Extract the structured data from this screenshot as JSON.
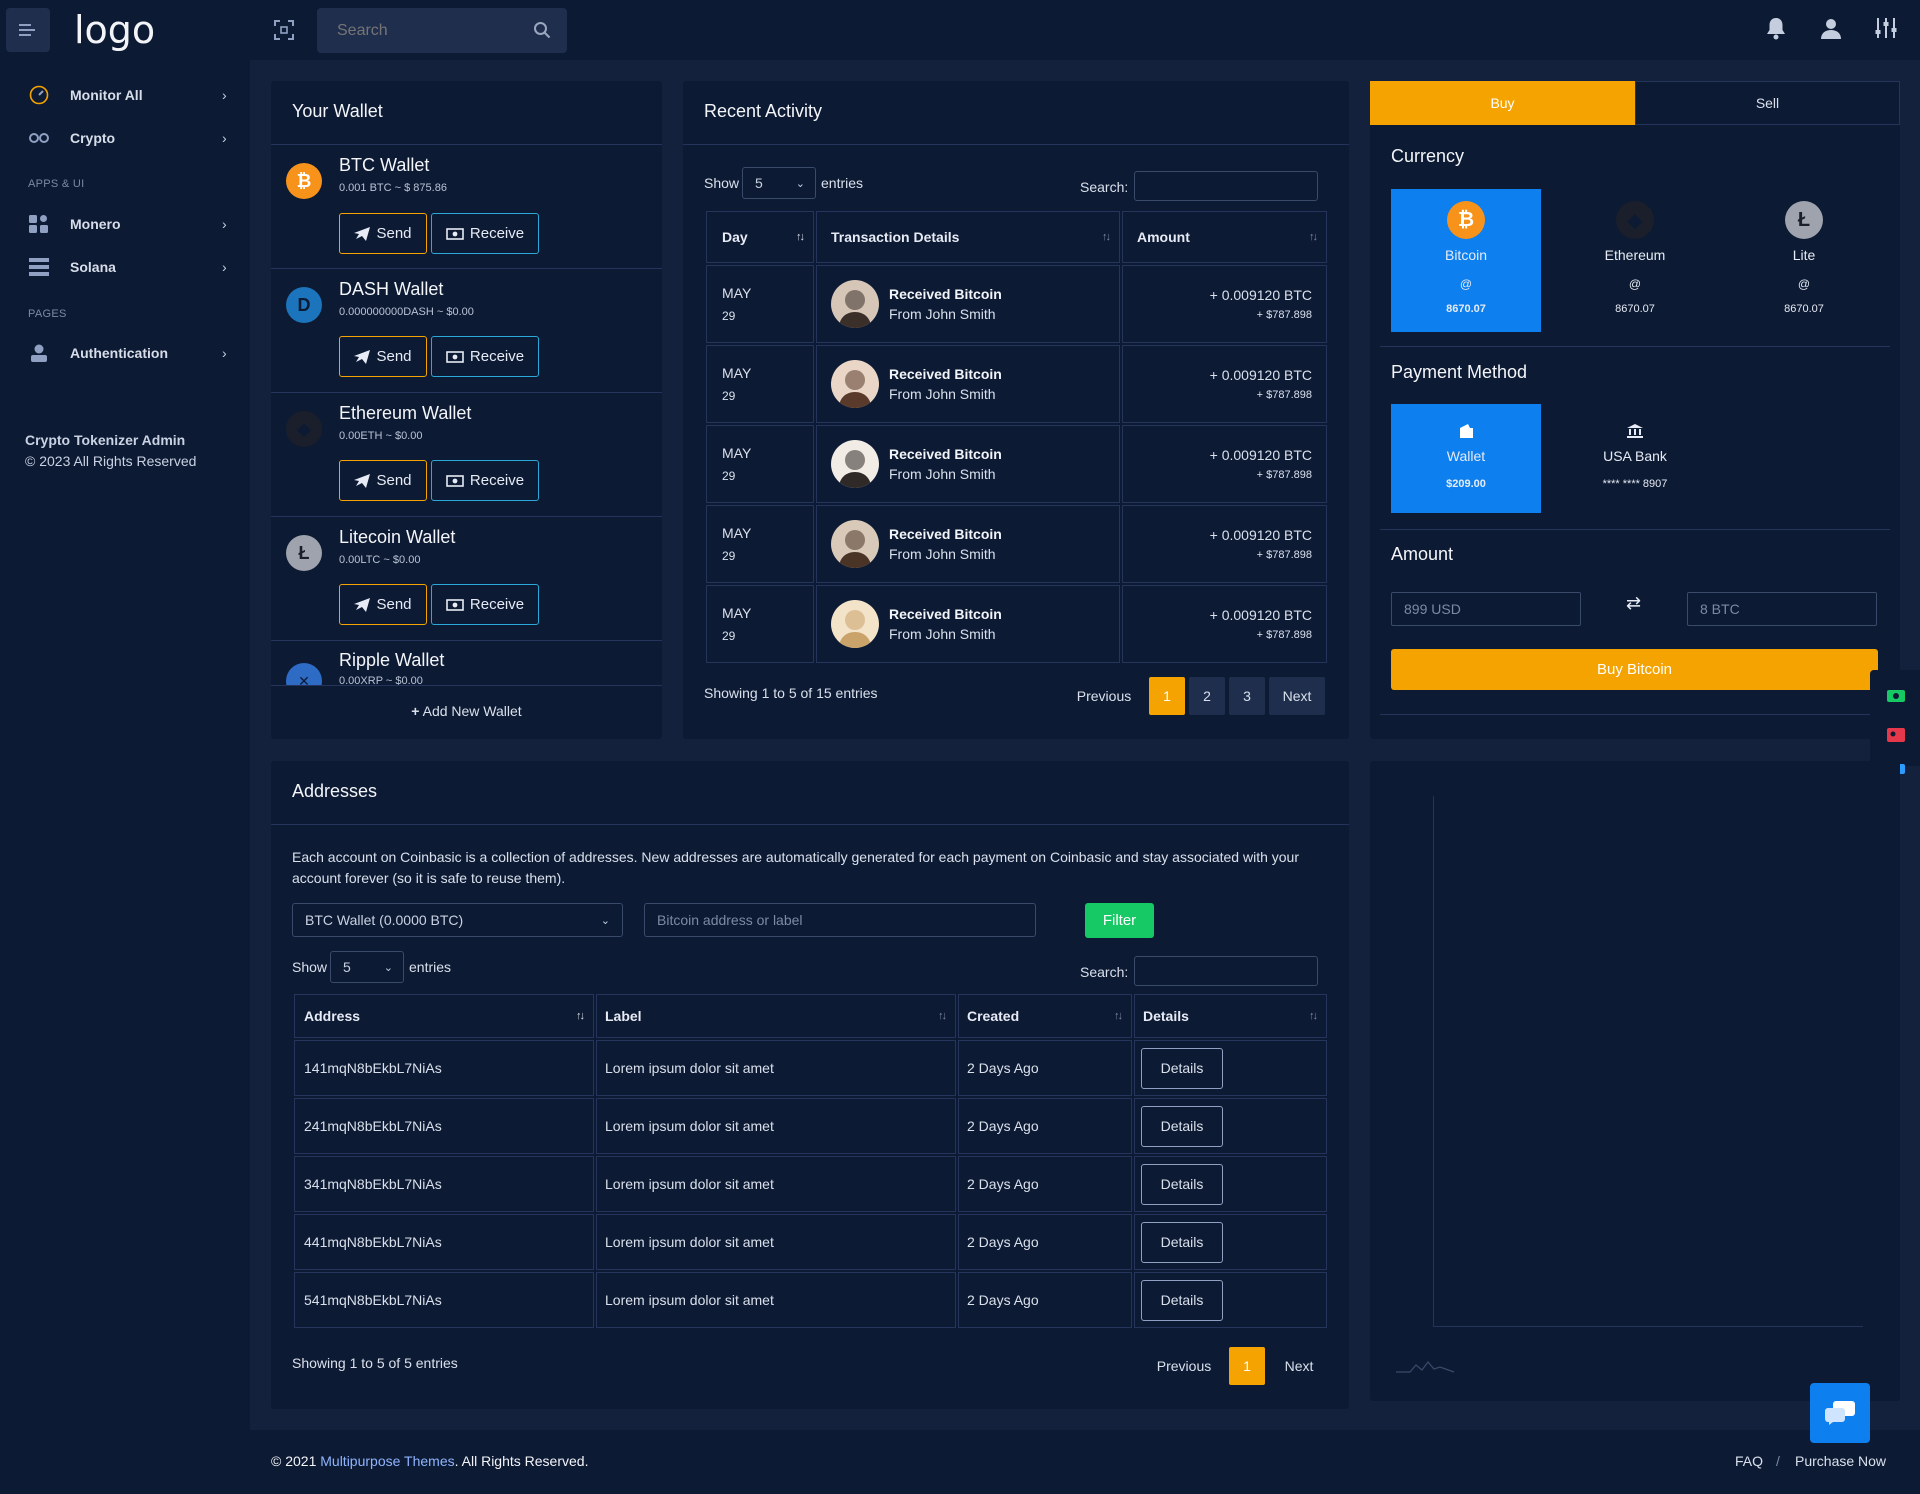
{
  "header": {
    "logo": "logo",
    "search_placeholder": "Search"
  },
  "sidebar": {
    "items": [
      {
        "label": "Monitor All"
      },
      {
        "label": "Crypto"
      },
      {
        "label": "Monero"
      },
      {
        "label": "Solana"
      },
      {
        "label": "Authentication"
      }
    ],
    "heading_apps": "APPS & UI",
    "heading_pages": "PAGES",
    "footer_title": "Crypto Tokenizer Admin",
    "footer_copy": "© 2023 All Rights Reserved"
  },
  "wallet": {
    "title": "Your Wallet",
    "send_label": "Send",
    "receive_label": "Receive",
    "add_label": "Add New Wallet",
    "wallets": [
      {
        "name": "BTC Wallet",
        "sub": "0.001 BTC ~ $ 875.86",
        "symbol": "₿"
      },
      {
        "name": "DASH Wallet",
        "sub": "0.000000000DASH ~ $0.00",
        "symbol": "D"
      },
      {
        "name": "Ethereum Wallet",
        "sub": "0.00ETH ~ $0.00",
        "symbol": "◆"
      },
      {
        "name": "Litecoin Wallet",
        "sub": "0.00LTC ~ $0.00",
        "symbol": "Ł"
      },
      {
        "name": "Ripple Wallet",
        "sub": "0.00XRP ~ $0.00",
        "symbol": "✕"
      }
    ]
  },
  "activity": {
    "title": "Recent Activity",
    "show": "Show",
    "entries": "entries",
    "page_size": "5",
    "search_label": "Search:",
    "headers": [
      "Day",
      "Transaction Details",
      "Amount"
    ],
    "rows": [
      {
        "month": "MAY",
        "day": "29",
        "title": "Received Bitcoin",
        "from": "From John Smith",
        "btc": "+ 0.009120 BTC",
        "usd": "+ $787.898"
      },
      {
        "month": "MAY",
        "day": "29",
        "title": "Received Bitcoin",
        "from": "From John Smith",
        "btc": "+ 0.009120 BTC",
        "usd": "+ $787.898"
      },
      {
        "month": "MAY",
        "day": "29",
        "title": "Received Bitcoin",
        "from": "From John Smith",
        "btc": "+ 0.009120 BTC",
        "usd": "+ $787.898"
      },
      {
        "month": "MAY",
        "day": "29",
        "title": "Received Bitcoin",
        "from": "From John Smith",
        "btc": "+ 0.009120 BTC",
        "usd": "+ $787.898"
      },
      {
        "month": "MAY",
        "day": "29",
        "title": "Received Bitcoin",
        "from": "From John Smith",
        "btc": "+ 0.009120 BTC",
        "usd": "+ $787.898"
      }
    ],
    "info": "Showing 1 to 5 of 15 entries",
    "prev": "Previous",
    "next": "Next",
    "pages": [
      "1",
      "2",
      "3"
    ]
  },
  "trade": {
    "tab_buy": "Buy",
    "tab_sell": "Sell",
    "currency_title": "Currency",
    "currencies": [
      {
        "name": "Bitcoin",
        "at": "@",
        "price": "8670.07"
      },
      {
        "name": "Ethereum",
        "at": "@",
        "price": "8670.07"
      },
      {
        "name": "Lite",
        "at": "@",
        "price": "8670.07"
      }
    ],
    "payment_title": "Payment Method",
    "methods": [
      {
        "name": "Wallet",
        "value": "$209.00"
      },
      {
        "name": "USA Bank",
        "value": "**** **** 8907"
      }
    ],
    "amount_title": "Amount",
    "usd_placeholder": "899 USD",
    "btc_placeholder": "8 BTC",
    "buy_button": "Buy Bitcoin"
  },
  "addresses": {
    "title": "Addresses",
    "description": "Each account on Coinbasic is a collection of addresses. New addresses are automatically generated for each payment on Coinbasic and stay associated with your account forever (so it is safe to reuse them).",
    "wallet_select": "BTC Wallet (0.0000 BTC)",
    "address_placeholder": "Bitcoin address or label",
    "filter_label": "Filter",
    "show": "Show",
    "entries": "entries",
    "page_size": "5",
    "search_label": "Search:",
    "headers": [
      "Address",
      "Label",
      "Created",
      "Details"
    ],
    "rows": [
      {
        "address": "141mqN8bEkbL7NiAs",
        "label": "Lorem ipsum dolor sit amet",
        "created": "2 Days Ago",
        "details": "Details"
      },
      {
        "address": "241mqN8bEkbL7NiAs",
        "label": "Lorem ipsum dolor sit amet",
        "created": "2 Days Ago",
        "details": "Details"
      },
      {
        "address": "341mqN8bEkbL7NiAs",
        "label": "Lorem ipsum dolor sit amet",
        "created": "2 Days Ago",
        "details": "Details"
      },
      {
        "address": "441mqN8bEkbL7NiAs",
        "label": "Lorem ipsum dolor sit amet",
        "created": "2 Days Ago",
        "details": "Details"
      },
      {
        "address": "541mqN8bEkbL7NiAs",
        "label": "Lorem ipsum dolor sit amet",
        "created": "2 Days Ago",
        "details": "Details"
      }
    ],
    "info": "Showing 1 to 5 of 5 entries",
    "prev": "Previous",
    "next": "Next",
    "page": "1"
  },
  "footer": {
    "copy_prefix": "© 2021 ",
    "copy_link": "Multipurpose Themes",
    "copy_suffix": ". All Rights Reserved.",
    "faq": "FAQ",
    "sep": "/",
    "purchase": "Purchase Now"
  },
  "colors": {
    "accent": "#f5a300",
    "primary_blue": "#0d7fee",
    "success_green": "#17c964",
    "background": "#0d1a33"
  }
}
